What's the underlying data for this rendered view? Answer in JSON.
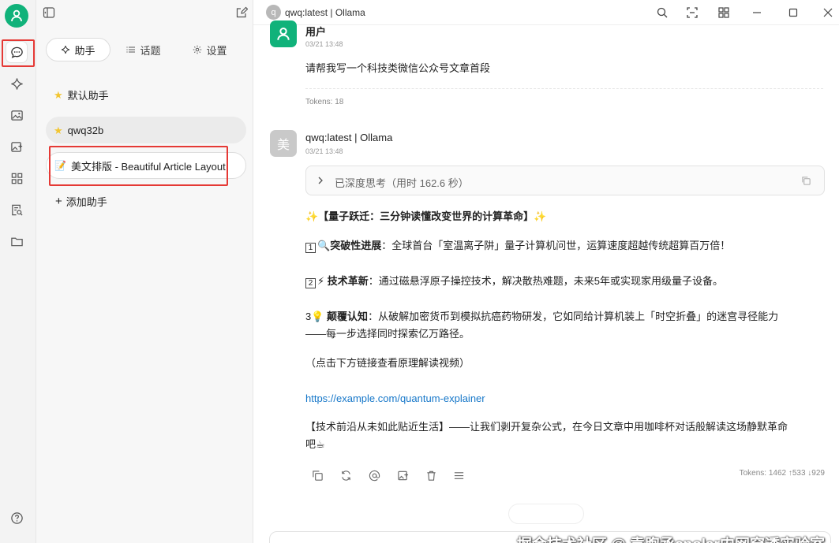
{
  "rail": {
    "items": [
      {
        "name": "chat-icon",
        "active": true
      },
      {
        "name": "sparkle-icon"
      },
      {
        "name": "image-icon"
      },
      {
        "name": "image-edit-icon"
      },
      {
        "name": "apps-icon"
      },
      {
        "name": "document-search-icon"
      },
      {
        "name": "folder-icon"
      }
    ],
    "help_icon": "help-icon"
  },
  "panel": {
    "tabs": [
      {
        "label": "助手",
        "icon": "sparkle-icon",
        "selected": true
      },
      {
        "label": "话题",
        "icon": "list-icon"
      },
      {
        "label": "设置",
        "icon": "gear-icon"
      }
    ],
    "assistants": [
      {
        "label": "默认助手",
        "icon": "star-icon"
      },
      {
        "label": "qwq32b",
        "icon": "star-icon",
        "selected": true
      },
      {
        "label": "美文排版 - Beautiful Article Layout",
        "icon": "memo-icon"
      }
    ],
    "add_label": "添加助手"
  },
  "titlebar": {
    "avatar_letter": "q",
    "title": "qwq:latest | Ollama"
  },
  "chat": {
    "user_msg": {
      "name": "用户",
      "time": "03/21 13:48",
      "text": "请帮我写一个科技类微信公众号文章首段",
      "tokens": "Tokens: 18"
    },
    "ai_msg": {
      "avatar": "美",
      "name": "qwq:latest | Ollama",
      "time": "03/21 13:48",
      "thinking": "已深度思考（用时 162.6 秒）",
      "headline": "✨【量子跃迁：三分钟读懂改变世界的计算革命】✨",
      "p1_num": "1",
      "p1_icon": "🔍",
      "p1_bold": "突破性进展",
      "p1_text": "：全球首台「室温离子阱」量子计算机问世，运算速度超越传统超算百万倍！",
      "p2_num": "2",
      "p2_icon": "⚡",
      "p2_bold": "技术革新",
      "p2_text": "：通过磁悬浮原子操控技术，解决散热难题，未来5年或实现家用级量子设备。",
      "p3_num": "3",
      "p3_icon": "💡",
      "p3_bold": "颠覆认知",
      "p3_text_a": "：从破解加密货币到模拟抗癌药物研发，它如同给计算机装上「时空折叠」的迷宫寻径能力",
      "p3_text_b": "——每一步选择同时探索亿万路径。",
      "hint": "（点击下方链接查看原理解读视频）",
      "link": "https://example.com/quantum-explainer",
      "outro_a": "【技术前沿从未如此贴近生活】——让我们剥开复杂公式，在今日文章中用咖啡杯对话般解读这场静默革命",
      "outro_b": "吧☕",
      "tokens": "Tokens: 1462 ↑533 ↓929"
    },
    "actions": [
      "copy-icon",
      "regenerate-icon",
      "mention-icon",
      "image-export-icon",
      "delete-icon",
      "menu-icon"
    ]
  },
  "watermark": "掘金技术社区 @ 袁煦丞cpolar内网穿透实验室",
  "colors": {
    "accent": "#10b27a",
    "highlight_box": "#e53935",
    "link": "#1677c9"
  }
}
